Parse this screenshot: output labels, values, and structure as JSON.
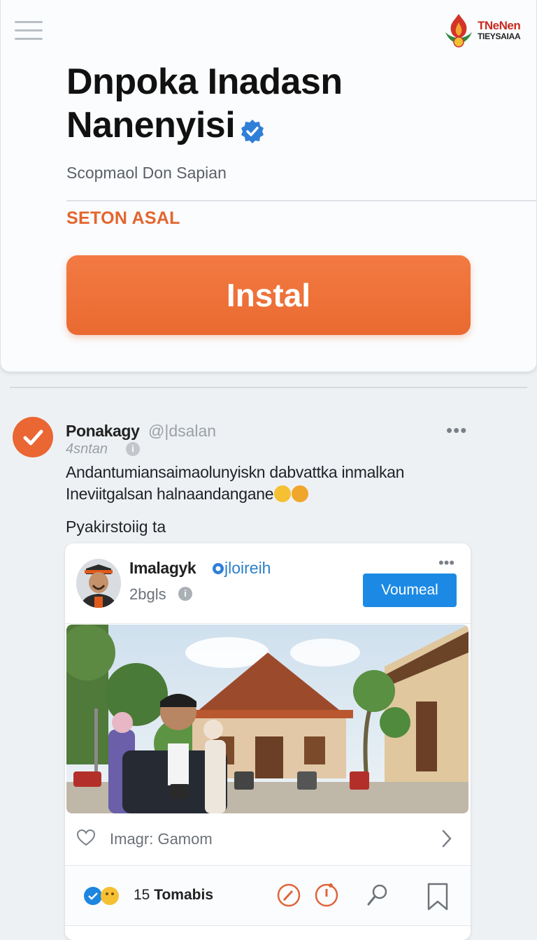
{
  "header": {
    "logo": {
      "line1": "TNeNen",
      "line2": "TIEYSAIAA"
    },
    "app_title": "Dnpoka Inadasn Nanenyisi",
    "developer": "Scopmaol Don Sapian",
    "section_label": "SETON ASAL",
    "install_label": "Instal",
    "accent_color": "#ea6a31"
  },
  "post": {
    "author": "Ponakagy",
    "handle": "@|dsalan",
    "time": "4sntan",
    "text": "Andantumiansaimaolunyiskn dabvattka inmalkan\nIneviitgalsan halnaandangane",
    "subtext": "Pyakirstoiig ta",
    "embed": {
      "author": "Imalagyk",
      "handle": "jloireih",
      "time": "2bgls",
      "follow_label": "Voumeal",
      "image_caption": "Imagr: Gamom",
      "reactions_count": "15",
      "reactions_label": "Tomabis"
    }
  },
  "icons": {
    "menu": "hamburger-icon",
    "verified": "verified-badge-icon",
    "more": "more-dots-icon",
    "heart": "heart-icon",
    "chevron": "chevron-right-icon",
    "comment": "comment-icon",
    "compass": "compass-icon",
    "search": "search-icon",
    "bookmark": "bookmark-icon"
  }
}
